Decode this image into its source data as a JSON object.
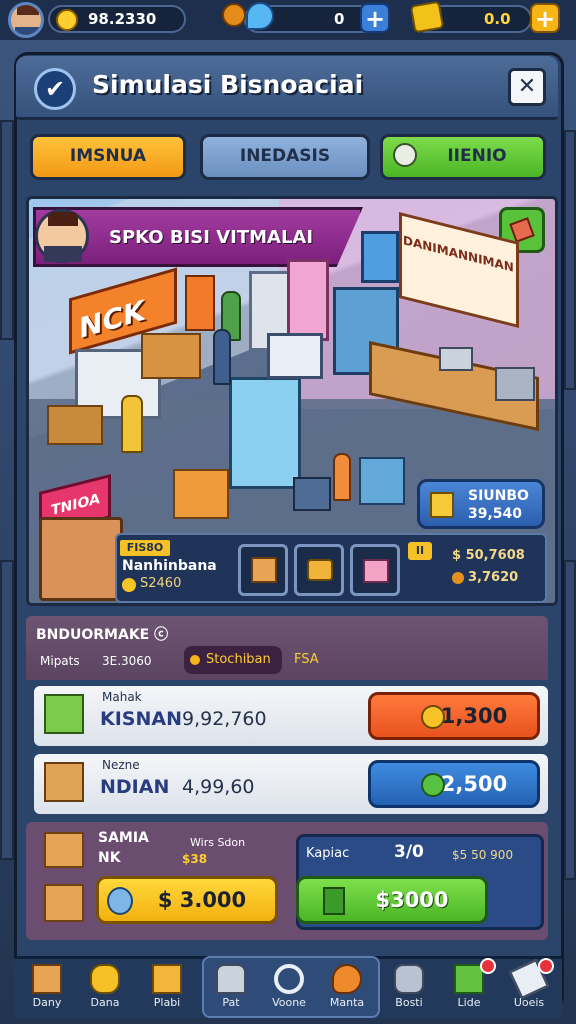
{
  "topbar": {
    "cash": "98.2330",
    "gems": "0",
    "gold": "0.0",
    "cash_icon": "dollar-coin-icon",
    "gems_icon": "blue-gem-icon",
    "gold_icon": "gold-card-icon"
  },
  "header": {
    "title": "Simulasi Bisnoaciai",
    "close": "✕"
  },
  "tabs": [
    {
      "label": "IMSNUA"
    },
    {
      "label": "INEDASIS"
    },
    {
      "label": "IIENIO"
    }
  ],
  "scene": {
    "banner": "SPKO BISI VITMALAI",
    "shop_sign": "NCK",
    "wall_sign": "DANIMANNIMAN",
    "stall_sign": "TNIOA",
    "info_btn_line1": "SIUNBO",
    "info_btn_line2": "39,540"
  },
  "shop_info": {
    "tag": "FIS8O",
    "name": "Nanhinbana",
    "value": "S2460",
    "stat1": "$ 50,7608",
    "stat2": "3,7620",
    "badge": "II"
  },
  "list": {
    "header": "BNDUORMAKE",
    "label": "Mipats",
    "value": "3E.3060",
    "chip": "Stochiban",
    "chip_extra": "FSA"
  },
  "items": [
    {
      "small": "Mahak",
      "name": "KISNAN",
      "amount": "9,92,760",
      "price": "1,300"
    },
    {
      "small": "Nezne",
      "name": "NDIAN",
      "amount": "4,99,60",
      "price": "2,500"
    }
  ],
  "bottom": {
    "title_line1": "SAMIA",
    "title_line2": "NK",
    "sub_label": "Wirs Sdon",
    "sub_value": "$38",
    "btn1": "$ 3.000",
    "kapital_label": "Kapiac",
    "kapital_value": "3/0",
    "kapital_price": "$5 50 900",
    "btn2": "$3000"
  },
  "nav": [
    {
      "label": "Dany",
      "icon": "box-icon"
    },
    {
      "label": "Dana",
      "icon": "puzzle-icon"
    },
    {
      "label": "Plabi",
      "icon": "clipboard-icon"
    },
    {
      "label": "Pat",
      "icon": "worker-icon"
    },
    {
      "label": "Voone",
      "icon": "ring-icon"
    },
    {
      "label": "Manta",
      "icon": "shovel-icon"
    },
    {
      "label": "Bosti",
      "icon": "gear-icon"
    },
    {
      "label": "Lide",
      "icon": "shop-icon"
    },
    {
      "label": "Uoeis",
      "icon": "eraser-icon"
    }
  ]
}
